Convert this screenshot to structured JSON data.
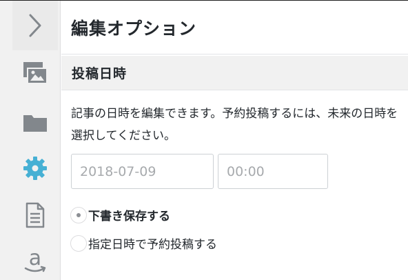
{
  "sidebar": {
    "icons": [
      {
        "name": "chevron-right-icon",
        "label": ">"
      },
      {
        "name": "media-icon"
      },
      {
        "name": "folder-icon"
      },
      {
        "name": "gear-icon",
        "color": "#46b0d4"
      },
      {
        "name": "document-icon"
      },
      {
        "name": "amazon-icon"
      }
    ]
  },
  "panel": {
    "title": "編集オプション"
  },
  "section": {
    "title": "投稿日時",
    "description": "記事の日時を編集できます。予約投稿するには、未来の日時を選択してください。"
  },
  "fields": {
    "date_placeholder": "2018-07-09",
    "time_placeholder": "00:00"
  },
  "options": [
    {
      "label": "下書き保存する",
      "checked": true
    },
    {
      "label": "指定日時で予約投稿する",
      "checked": false
    }
  ],
  "colors": {
    "accent": "#46b0d4",
    "icon_gray": "#82878c",
    "rail_bg": "#f1f1f1"
  }
}
